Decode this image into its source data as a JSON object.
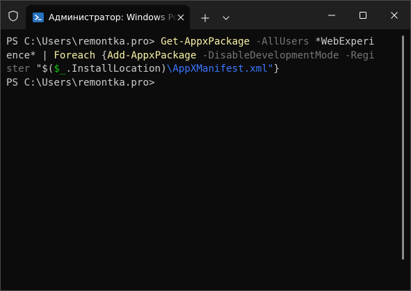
{
  "titlebar": {
    "tab_title": "Администратор: Windows Po",
    "icons": {
      "shield": "shield-icon",
      "tab": "powershell-icon",
      "close": "close-icon",
      "new_tab": "plus-icon",
      "dropdown": "chevron-down-icon",
      "minimize": "minimize-icon",
      "maximize": "maximize-icon",
      "window_close": "close-icon"
    }
  },
  "terminal": {
    "colors": {
      "background": "#0c0c0c",
      "text": "#cccccc",
      "command": "#f9f1a5",
      "parameter": "#767676",
      "string": "#3b78ff",
      "variable": "#16c60c"
    },
    "lines": [
      [
        {
          "t": "PS C:\\Users\\remontka.pro> ",
          "c": "plain"
        },
        {
          "t": "Get-AppxPackage",
          "c": "cmd"
        },
        {
          "t": " ",
          "c": "plain"
        },
        {
          "t": "-AllUsers",
          "c": "param"
        },
        {
          "t": " *WebExperi",
          "c": "plain"
        }
      ],
      [
        {
          "t": "ence* | ",
          "c": "plain"
        },
        {
          "t": "Foreach",
          "c": "cmd"
        },
        {
          "t": " {",
          "c": "plain"
        },
        {
          "t": "Add-AppxPackage",
          "c": "cmd"
        },
        {
          "t": " ",
          "c": "plain"
        },
        {
          "t": "-DisableDevelopmentMode",
          "c": "param"
        },
        {
          "t": " ",
          "c": "plain"
        },
        {
          "t": "-Regi",
          "c": "param"
        }
      ],
      [
        {
          "t": "ster",
          "c": "param"
        },
        {
          "t": " \"$(",
          "c": "plain"
        },
        {
          "t": "$_",
          "c": "var"
        },
        {
          "t": ".InstallLocation)",
          "c": "plain"
        },
        {
          "t": "\\AppXManifest.xml\"",
          "c": "str"
        },
        {
          "t": "}",
          "c": "plain"
        }
      ],
      [
        {
          "t": "PS C:\\Users\\remontka.pro>",
          "c": "plain"
        }
      ]
    ]
  }
}
